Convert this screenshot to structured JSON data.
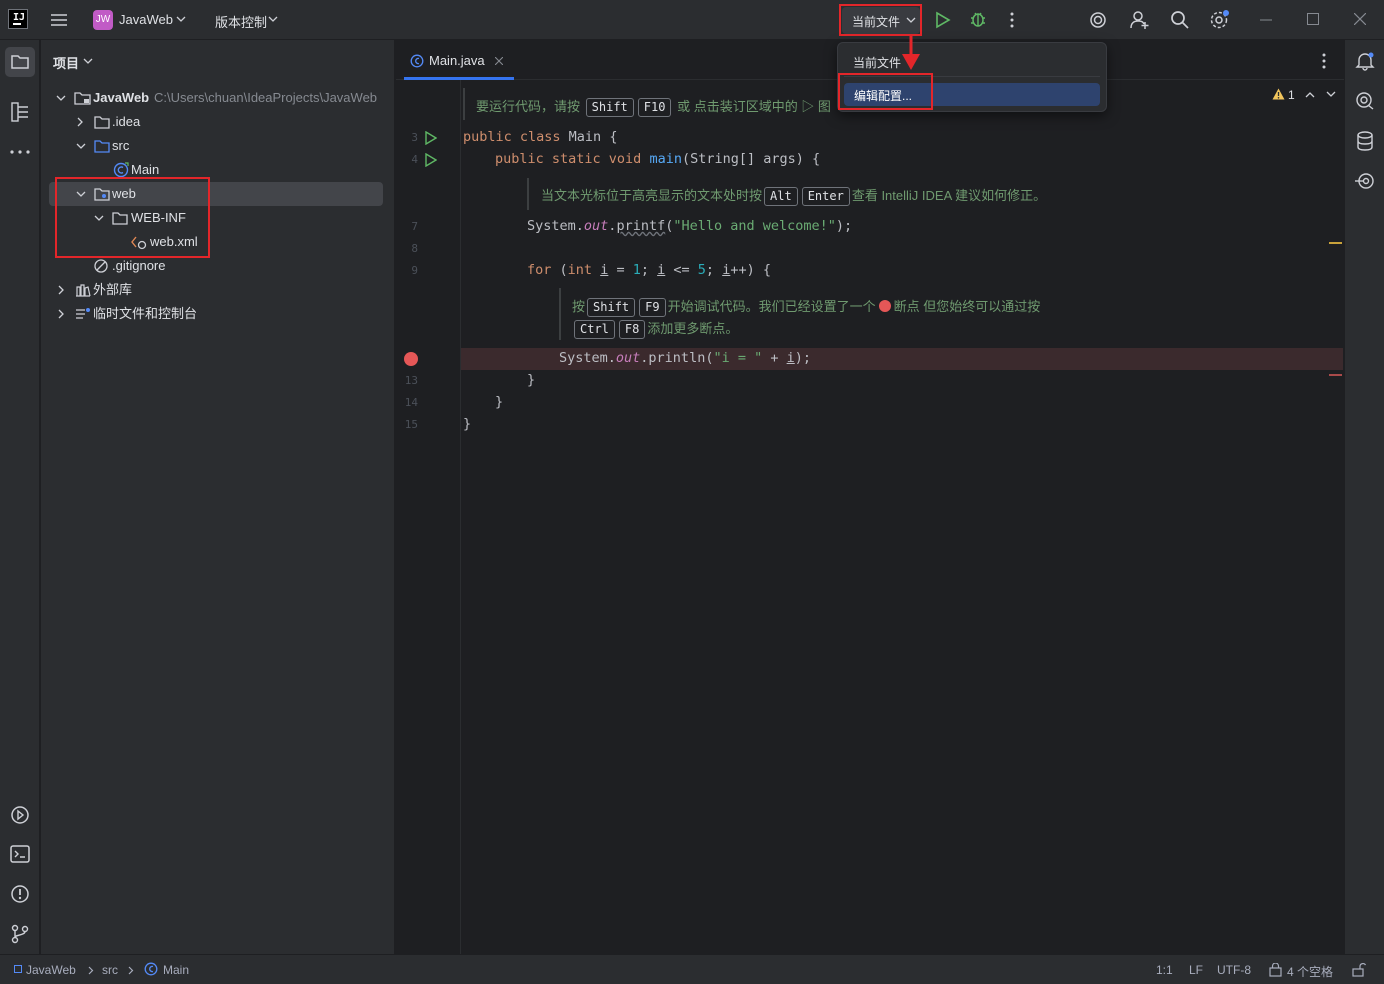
{
  "titlebar": {
    "project_badge": "JW",
    "project_name": "JavaWeb",
    "vcs_label": "版本控制",
    "run_config_label": "当前文件"
  },
  "run_config_popup": {
    "items": [
      {
        "label": "当前文件"
      },
      {
        "label": "编辑配置..."
      }
    ]
  },
  "project_panel": {
    "title": "项目",
    "tree": [
      {
        "label": "JavaWeb",
        "path": "C:\\Users\\chuan\\IdeaProjects\\JavaWeb",
        "icon": "module-folder-icon"
      },
      {
        "label": ".idea",
        "icon": "folder-icon"
      },
      {
        "label": "src",
        "icon": "source-folder-icon"
      },
      {
        "label": "Main",
        "icon": "java-class-icon"
      },
      {
        "label": "web",
        "icon": "web-folder-icon"
      },
      {
        "label": "WEB-INF",
        "icon": "folder-icon"
      },
      {
        "label": "web.xml",
        "icon": "xml-file-icon"
      },
      {
        "label": ".gitignore",
        "icon": "ignored-file-icon"
      },
      {
        "label": "外部库",
        "icon": "library-icon"
      },
      {
        "label": "临时文件和控制台",
        "icon": "scratches-icon"
      }
    ]
  },
  "editor": {
    "tab_label": "Main.java",
    "warnings_count": "1",
    "hint_run": {
      "prefix": "要运行代码，请按",
      "k1": "Shift",
      "k2": "F10",
      "suffix": "或 点击装订区域中的 ▷ 图"
    },
    "hint_intention": {
      "prefix": "当文本光标位于高亮显示的文本处时按",
      "k1": "Alt",
      "k2": "Enter",
      "suffix": "查看 IntelliJ IDEA 建议如何修正。"
    },
    "hint_debug": {
      "prefix": "按",
      "k1": "Shift",
      "k2": "F9",
      "middle": "开始调试代码。我们已经设置了一个",
      "middle2": "断点 但您始终可以通过按",
      "k3": "Ctrl",
      "k4": "F8",
      "suffix": "添加更多断点。"
    },
    "line_numbers": [
      "3",
      "4",
      "7",
      "8",
      "9",
      "13",
      "14",
      "15"
    ]
  },
  "statusbar": {
    "breadcrumb": [
      "JavaWeb",
      "src",
      "Main"
    ],
    "position": "1:1",
    "line_sep": "LF",
    "encoding": "UTF-8",
    "indent": "4 个空格"
  },
  "colors": {
    "accent": "#3574f0",
    "highlight_red": "#e3262a",
    "breakpoint": "#e55757"
  }
}
